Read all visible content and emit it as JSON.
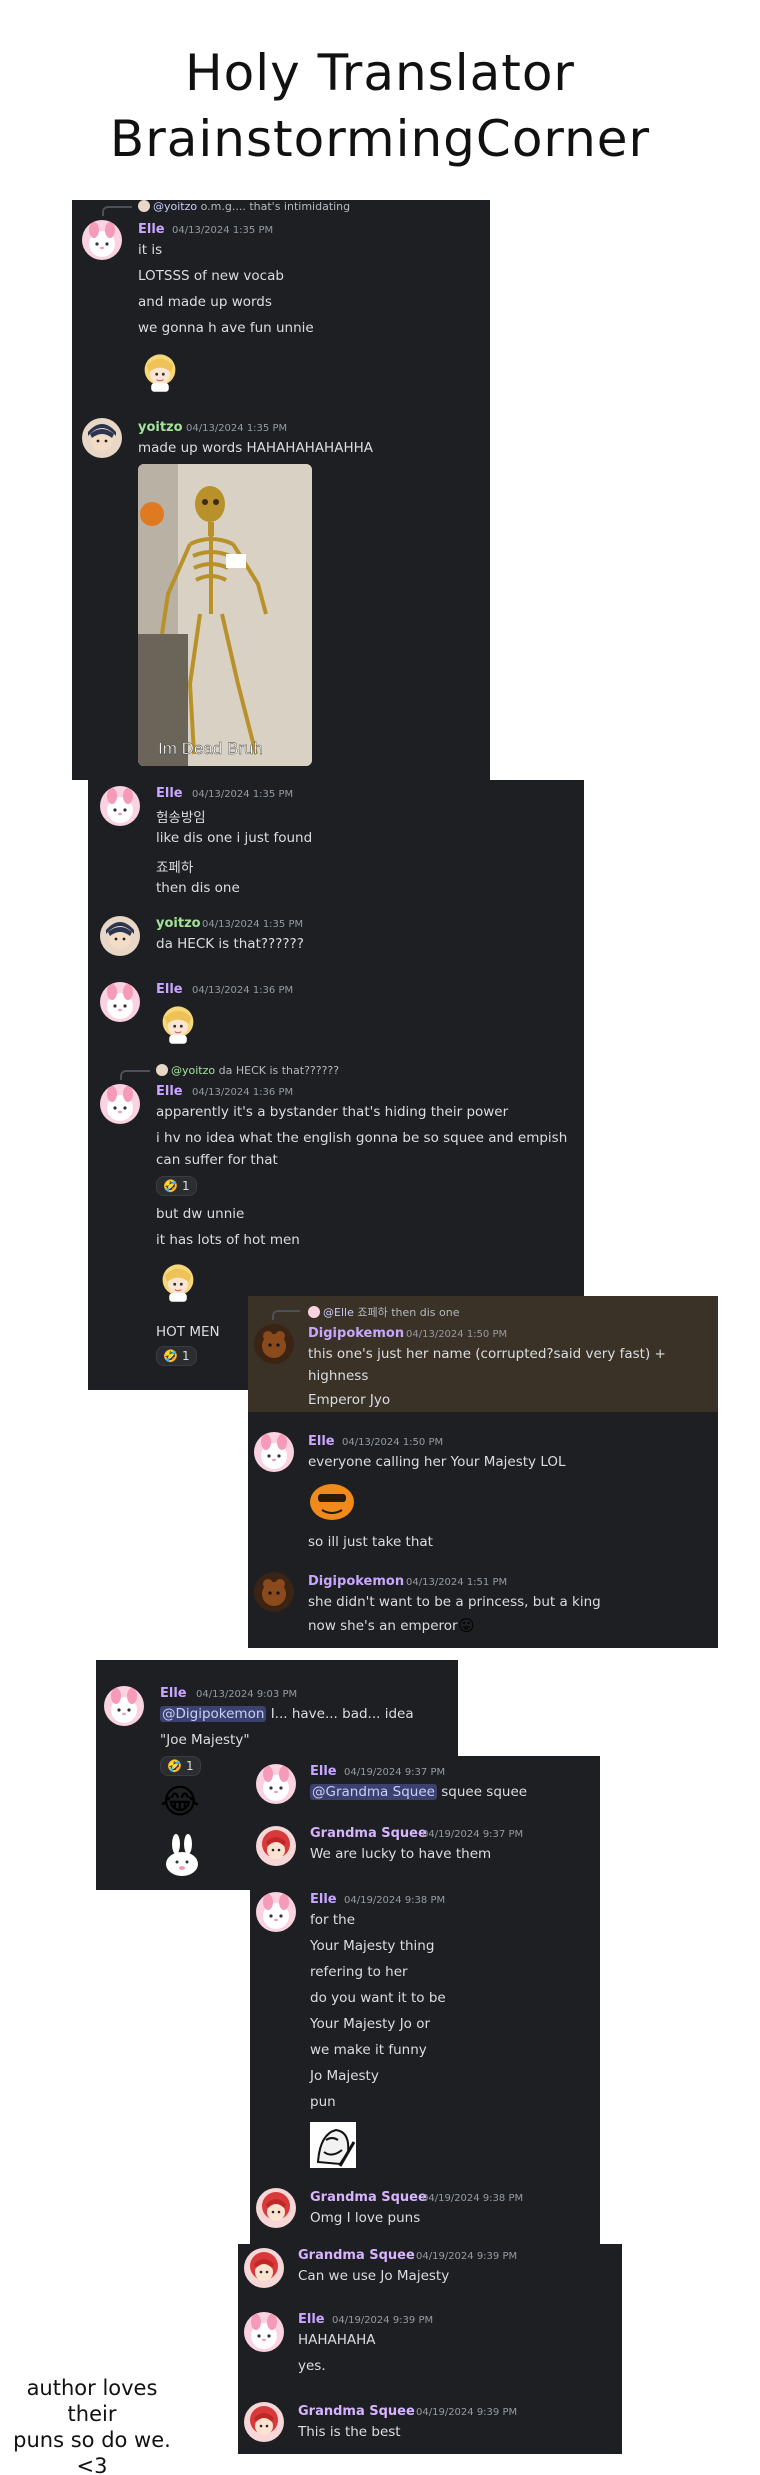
{
  "title": {
    "line1": "Holy Translator",
    "line2": "BrainstormingCorner"
  },
  "colors": {
    "elle": "#c9a6ff",
    "yoitzo": "#a4e29b",
    "digi": "#c9a6ff",
    "grandma": "#d7b4ff",
    "bg": "#1e1f22"
  },
  "panel1": {
    "reply": {
      "user": "@yoitzo",
      "text": "o.m.g.... that's intimidating"
    },
    "m1": {
      "name": "Elle",
      "ts": "04/13/2024 1:35 PM",
      "lines": [
        "it is",
        "LOTSSS of new vocab",
        "and made up words",
        "we gonna h ave fun unnie"
      ]
    },
    "m2": {
      "name": "yoitzo",
      "ts": "04/13/2024 1:35 PM",
      "lines": [
        "made up words HAHAHAHAHAHHA"
      ],
      "gif_caption": "Im Dead Bruh"
    }
  },
  "panel2": {
    "m1": {
      "name": "Elle",
      "ts": "04/13/2024 1:35 PM",
      "lines": [
        "험송방임",
        "like dis one i just found",
        "죠페하",
        "then dis one"
      ]
    },
    "m2": {
      "name": "yoitzo",
      "ts": "04/13/2024 1:35 PM",
      "lines": [
        "da HECK is that??????"
      ]
    },
    "m3": {
      "name": "Elle",
      "ts": "04/13/2024 1:36 PM"
    },
    "reply": {
      "user": "@yoitzo",
      "text": "da HECK is that??????"
    },
    "m4": {
      "name": "Elle",
      "ts": "04/13/2024 1:36 PM",
      "lines": [
        "apparently it's a bystander that's hiding their power",
        "i hv no idea what the english gonna be so squee and empish",
        "can suffer for that",
        "but dw unnie",
        "it has lots of hot men",
        "HOT MEN"
      ],
      "reaction_count": "1",
      "reaction_count2": "1"
    }
  },
  "panel3": {
    "reply": {
      "user": "@Elle",
      "text": "죠페하 then dis one"
    },
    "m1": {
      "name": "Digipokemon",
      "ts": "04/13/2024 1:50 PM",
      "lines": [
        "this one's just her name (corrupted?said very fast) +",
        "highness",
        "Emperor Jyo"
      ]
    },
    "m2": {
      "name": "Elle",
      "ts": "04/13/2024 1:50 PM",
      "lines": [
        "everyone calling her Your Majesty LOL",
        "so ill just take that"
      ]
    },
    "m3": {
      "name": "Digipokemon",
      "ts": "04/13/2024 1:51 PM",
      "lines": [
        "she didn't want to be a princess, but a king",
        "now she's an emperor"
      ]
    }
  },
  "panel4": {
    "m1": {
      "name": "Elle",
      "ts": "04/13/2024 9:03 PM",
      "mention": "@Digipokemon",
      "text": " I... have... bad... idea",
      "line2": "\"Joe Majesty\"",
      "reaction_count": "1"
    }
  },
  "panel5": {
    "m1": {
      "name": "Elle",
      "ts": "04/19/2024 9:37 PM",
      "mention": "@Grandma Squee",
      "text": " squee squee"
    },
    "m2": {
      "name": "Grandma Squee",
      "ts": "04/19/2024 9:37 PM",
      "lines": [
        "We are lucky to have them"
      ]
    },
    "m3": {
      "name": "Elle",
      "ts": "04/19/2024 9:38 PM",
      "lines": [
        "for the",
        "Your Majesty thing",
        "refering to her",
        "do you want it to be",
        "Your Majesty Jo or",
        "we make it funny",
        "Jo Majesty",
        "pun"
      ]
    },
    "m4": {
      "name": "Grandma Squee",
      "ts": "04/19/2024 9:38 PM",
      "lines": [
        "Omg I love puns"
      ]
    }
  },
  "panel6": {
    "m1": {
      "name": "Grandma Squee",
      "ts": "04/19/2024 9:39 PM",
      "lines": [
        "Can we use Jo Majesty"
      ]
    },
    "m2": {
      "name": "Elle",
      "ts": "04/19/2024 9:39 PM",
      "lines": [
        "HAHAHAHA",
        "yes."
      ]
    },
    "m3": {
      "name": "Grandma Squee",
      "ts": "04/19/2024 9:39 PM",
      "lines": [
        "This is the best"
      ]
    }
  },
  "footnote": {
    "line1": "author loves their",
    "line2": "puns so do we.",
    "line3": "<3"
  }
}
